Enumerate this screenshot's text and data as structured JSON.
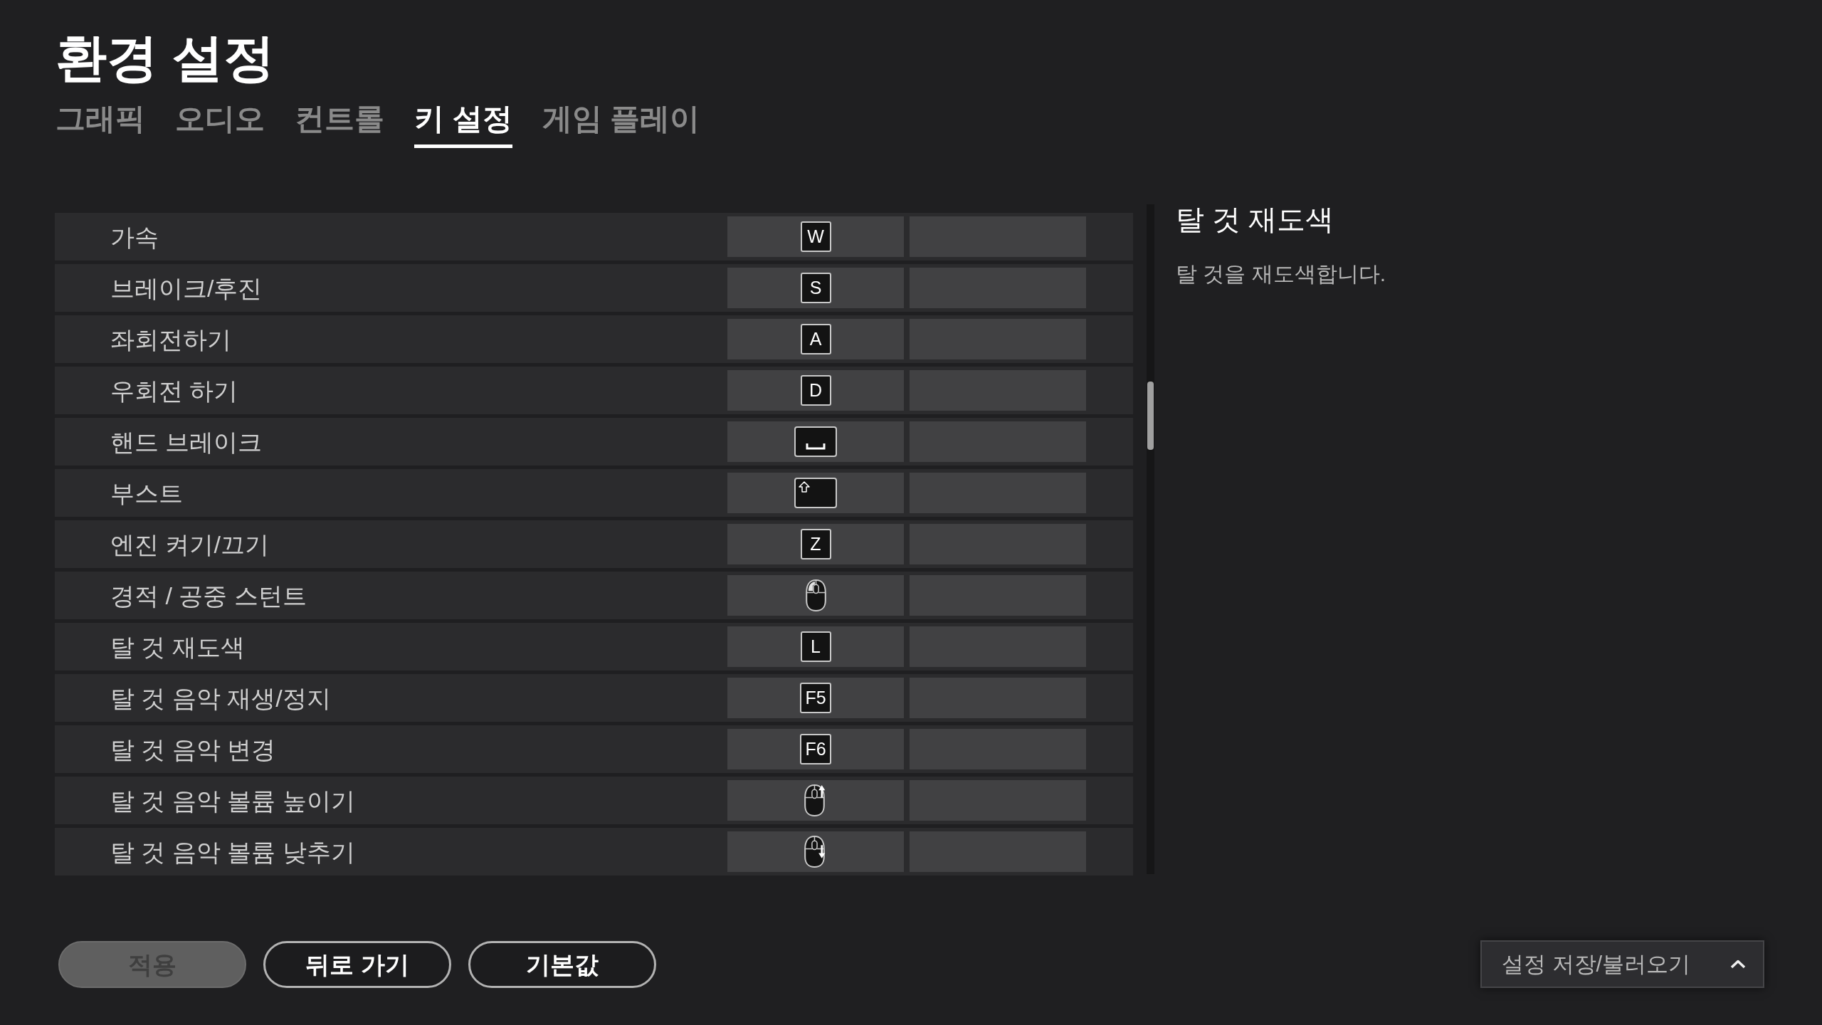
{
  "window": {
    "title": "환경 설정"
  },
  "tabs": [
    {
      "label": "그래픽",
      "selected": false
    },
    {
      "label": "오디오",
      "selected": false
    },
    {
      "label": "컨트롤",
      "selected": false
    },
    {
      "label": "키 설정",
      "selected": true
    },
    {
      "label": "게임 플레이",
      "selected": false
    }
  ],
  "bindings": [
    {
      "action": "가속",
      "primary": {
        "kind": "key",
        "label": "W"
      }
    },
    {
      "action": "브레이크/후진",
      "primary": {
        "kind": "key",
        "label": "S"
      }
    },
    {
      "action": "좌회전하기",
      "primary": {
        "kind": "key",
        "label": "A"
      }
    },
    {
      "action": "우회전 하기",
      "primary": {
        "kind": "key",
        "label": "D"
      }
    },
    {
      "action": "핸드 브레이크",
      "primary": {
        "kind": "spacebar"
      }
    },
    {
      "action": "부스트",
      "primary": {
        "kind": "shift"
      }
    },
    {
      "action": "엔진 켜기/끄기",
      "primary": {
        "kind": "key",
        "label": "Z"
      }
    },
    {
      "action": "경적 / 공중 스턴트",
      "primary": {
        "kind": "leftclick"
      }
    },
    {
      "action": "탈 것 재도색",
      "primary": {
        "kind": "key",
        "label": "L"
      }
    },
    {
      "action": "탈 것 음악 재생/정지",
      "primary": {
        "kind": "key",
        "label": "F5"
      }
    },
    {
      "action": "탈 것 음악 변경",
      "primary": {
        "kind": "key",
        "label": "F6"
      }
    },
    {
      "action": "탈 것 음악 볼륨 높이기",
      "primary": {
        "kind": "wheelup"
      }
    },
    {
      "action": "탈 것 음악 볼륨 낮추기",
      "primary": {
        "kind": "wheeldown"
      }
    }
  ],
  "detail": {
    "title": "탈 것 재도색",
    "description": "탈 것을 재도색합니다."
  },
  "buttons": [
    {
      "label": "적용",
      "disabled": true
    },
    {
      "label": "뒤로 가기",
      "disabled": false
    },
    {
      "label": "기본값",
      "disabled": false
    }
  ],
  "preset_menu": {
    "label": "설정 저장/불러오기"
  }
}
